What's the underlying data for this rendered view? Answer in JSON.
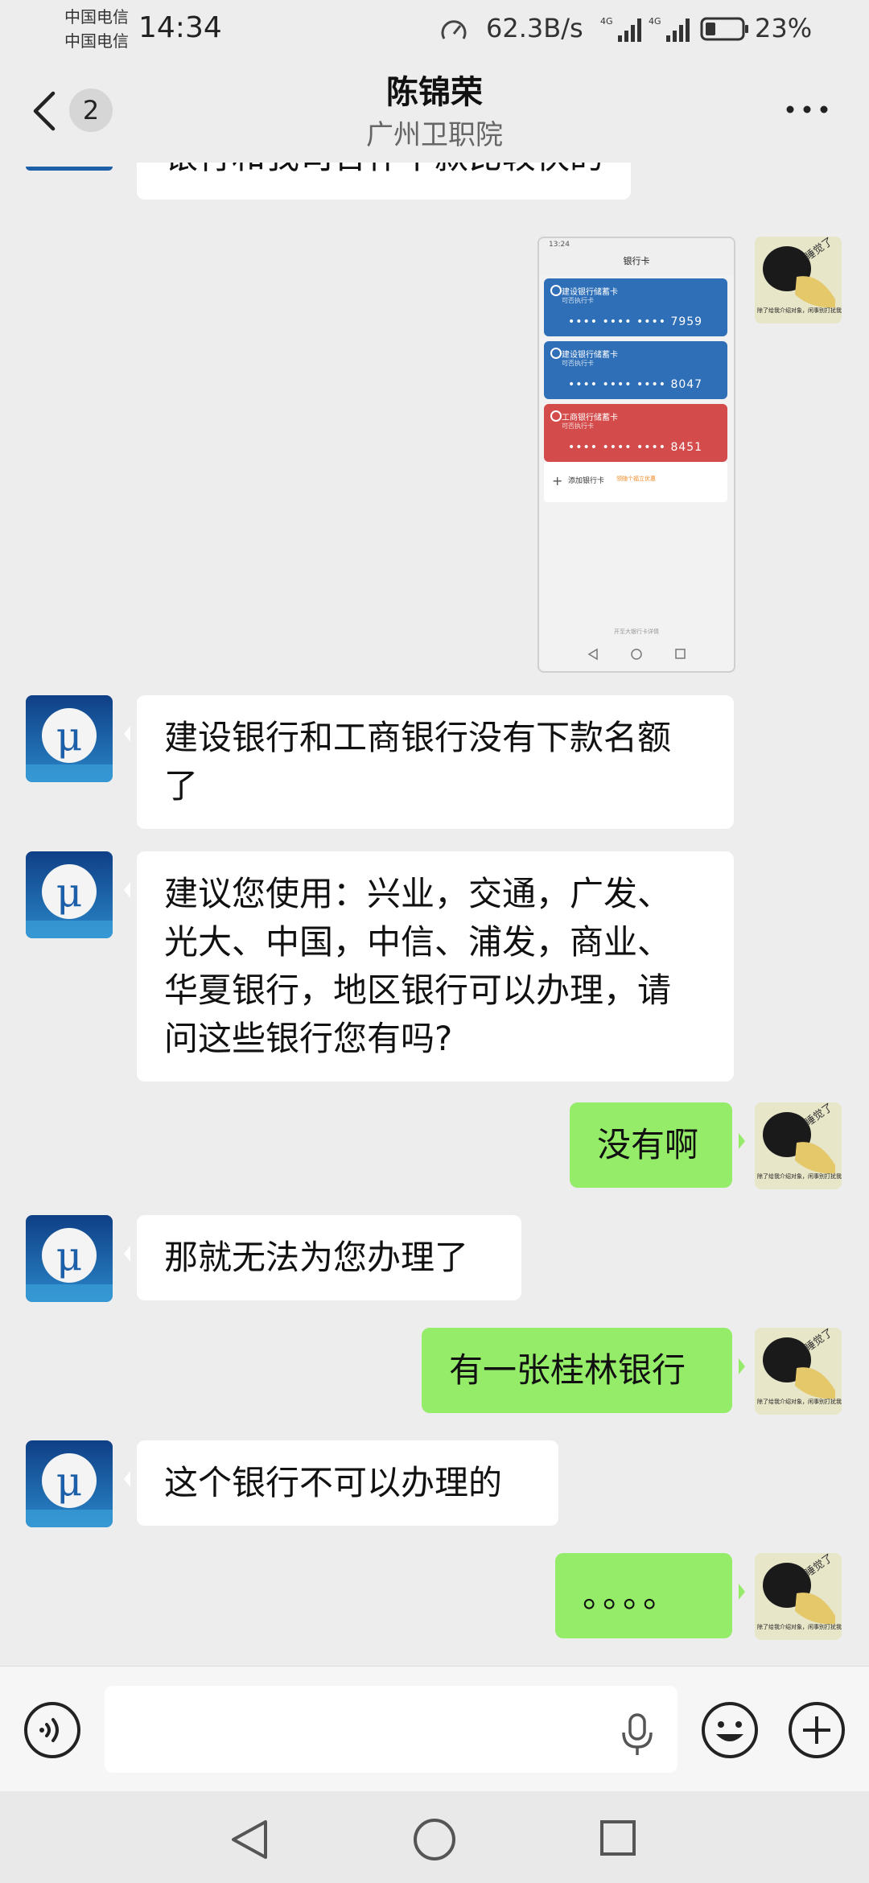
{
  "status_bar": {
    "carrier_1": "中国电信",
    "carrier_2": "中国电信",
    "time": "14:34",
    "net_speed": "62.3B/s",
    "signal_label": "4G",
    "battery": "23%",
    "icons": [
      "speed-meter-icon",
      "signal-4g-icon",
      "battery-icon"
    ]
  },
  "header": {
    "back_icon": "chevron-left-icon",
    "unread_count": "2",
    "title": "陈锦荣",
    "subtitle": "广州卫职院",
    "more_icon": "ellipsis-icon"
  },
  "screenshot_image": {
    "status": "13:24",
    "title": "银行卡",
    "cards": [
      {
        "name": "建设银行储蓄卡",
        "sub": "可否执行卡",
        "number": "•••• •••• •••• 7959",
        "color": "#2f6fb8"
      },
      {
        "name": "建设银行储蓄卡",
        "sub": "可否执行卡",
        "number": "•••• •••• •••• 8047",
        "color": "#2f6fb8"
      },
      {
        "name": "工商银行储蓄卡",
        "sub": "可否执行卡",
        "number": "•••• •••• •••• 8451",
        "color": "#d44b4b"
      }
    ],
    "add_card": "添加银行卡",
    "add_card_tag": "领随个福立优惠",
    "footer": "开至大银行卡详情"
  },
  "messages": [
    {
      "side": "in",
      "text": "银行和我司合作下款比较快的"
    },
    {
      "side": "out",
      "type": "image"
    },
    {
      "side": "in",
      "text": "建设银行和工商银行没有下款名额\n了"
    },
    {
      "side": "in",
      "text": "建议您使用：兴业，交通，广发、\n光大、中国，中信、浦发，商业、\n华夏银行，地区银行可以办理，请\n问这些银行您有吗?"
    },
    {
      "side": "out",
      "text": "没有啊"
    },
    {
      "side": "in",
      "text": "那就无法为您办理了"
    },
    {
      "side": "out",
      "text": "有一张桂林银行"
    },
    {
      "side": "in",
      "text": "这个银行不可以办理的"
    },
    {
      "side": "out",
      "text": "。。。。"
    }
  ],
  "avatar_self_text": [
    "睡觉了",
    "除了给我介绍对象，闲事别打扰我！"
  ],
  "input_bar": {
    "value": "",
    "icons": [
      "voice-icon",
      "microphone-icon",
      "emoji-icon",
      "plus-icon"
    ]
  },
  "nav_bar": {
    "icons": [
      "nav-back-icon",
      "nav-home-icon",
      "nav-recent-icon"
    ]
  },
  "colors": {
    "background": "#ededed",
    "incoming_bubble": "#ffffff",
    "outgoing_bubble": "#95ec69"
  }
}
